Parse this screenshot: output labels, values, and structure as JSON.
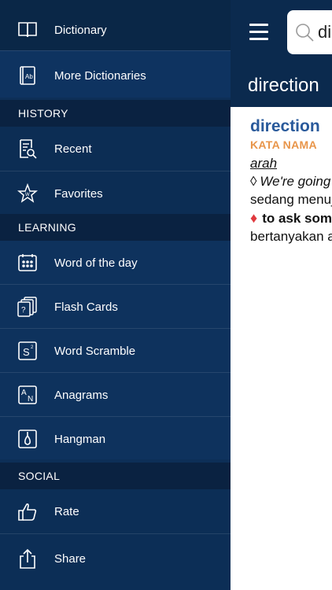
{
  "drawer": {
    "items_top": [
      {
        "name": "menu-item-dictionary",
        "icon": "book-icon",
        "label": "Dictionary"
      },
      {
        "name": "menu-item-more-dictionaries",
        "icon": "book-ab-icon",
        "label": "More Dictionaries"
      }
    ],
    "history": {
      "header": "HISTORY",
      "items": [
        {
          "name": "menu-item-recent",
          "icon": "recent-list-icon",
          "label": "Recent"
        },
        {
          "name": "menu-item-favorites",
          "icon": "star-icon",
          "label": "Favorites"
        }
      ]
    },
    "learning": {
      "header": "LEARNING",
      "items": [
        {
          "name": "menu-item-word-of-the-day",
          "icon": "calendar-icon",
          "label": "Word of the day"
        },
        {
          "name": "menu-item-flash-cards",
          "icon": "flash-cards-icon",
          "label": "Flash Cards"
        },
        {
          "name": "menu-item-word-scramble",
          "icon": "scramble-icon",
          "label": "Word Scramble"
        },
        {
          "name": "menu-item-anagrams",
          "icon": "anagrams-icon",
          "label": "Anagrams"
        },
        {
          "name": "menu-item-hangman",
          "icon": "hangman-icon",
          "label": "Hangman"
        }
      ]
    },
    "social": {
      "header": "SOCIAL",
      "items": [
        {
          "name": "menu-item-rate",
          "icon": "thumbs-up-icon",
          "label": "Rate"
        },
        {
          "name": "menu-item-share",
          "icon": "share-icon",
          "label": "Share"
        }
      ]
    }
  },
  "search": {
    "value": "direction",
    "placeholder": ""
  },
  "word_title": "direction",
  "entry": {
    "headword": "direction",
    "part_of_speech": "KATA NAMA",
    "translation": "arah",
    "example_marker": "◊",
    "example_en": "We're going in the right direction.",
    "example_ms": "sedang menuju ke arah yang betul.",
    "phrase": "to ask someone for directions",
    "phrase_ms": "bertanyakan arah"
  },
  "colors": {
    "drawer_bg": "#0d2f57",
    "header_bg": "#0a2241",
    "headword": "#2a5a9b",
    "pos": "#e8954a",
    "diamond": "#e0393e"
  }
}
